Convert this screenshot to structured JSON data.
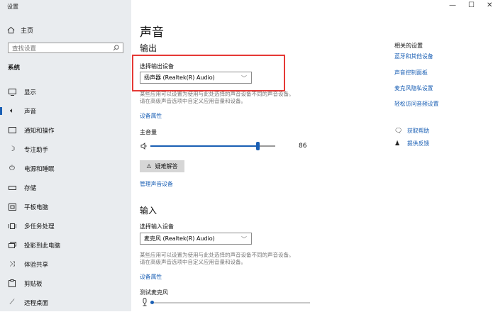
{
  "window": {
    "title": "设置",
    "controls": {
      "minimize": "—",
      "maximize": "☐",
      "close": "✕"
    }
  },
  "sidebar": {
    "home_label": "主页",
    "search_placeholder": "查找设置",
    "section": "系统",
    "items": [
      {
        "label": "显示",
        "icon": "monitor-icon"
      },
      {
        "label": "声音",
        "icon": "speaker-icon",
        "active": true
      },
      {
        "label": "通知和操作",
        "icon": "notification-icon"
      },
      {
        "label": "专注助手",
        "icon": "moon-icon"
      },
      {
        "label": "电源和睡眠",
        "icon": "power-icon"
      },
      {
        "label": "存储",
        "icon": "storage-icon"
      },
      {
        "label": "平板电脑",
        "icon": "tablet-icon"
      },
      {
        "label": "多任务处理",
        "icon": "multitask-icon"
      },
      {
        "label": "投影到此电脑",
        "icon": "projector-icon"
      },
      {
        "label": "体验共享",
        "icon": "share-icon"
      },
      {
        "label": "剪贴板",
        "icon": "clipboard-icon"
      },
      {
        "label": "远程桌面",
        "icon": "remote-icon"
      }
    ]
  },
  "main": {
    "title": "声音",
    "output": {
      "heading": "输出",
      "select_label": "选择输出设备",
      "device": "扬声器 (Realtek(R) Audio)",
      "desc_line1": "某些应用可以设置为使用与此处选择的声音设备不同的声音设备。",
      "desc_line2": "请在高级声音选项中自定义应用音量和设备。",
      "properties_link": "设备属性",
      "volume_label": "主音量",
      "volume_value": "86",
      "volume_fraction": 0.86,
      "troubleshoot": "疑难解答",
      "manage_link": "管理声音设备"
    },
    "input": {
      "heading": "输入",
      "select_label": "选择输入设备",
      "device": "麦克风 (Realtek(R) Audio)",
      "desc_line1": "某些应用可以设置为使用与此处选择的声音设备不同的声音设备。",
      "desc_line2": "请在高级声音选项中自定义应用音量和设备。",
      "properties_link": "设备属性",
      "test_label": "测试麦克风"
    }
  },
  "related": {
    "heading": "相关的设置",
    "links": [
      "蓝牙和其他设备",
      "声音控制面板",
      "麦克风隐私设置",
      "轻松访问音频设置"
    ],
    "help": "获取帮助",
    "feedback": "提供反馈"
  },
  "colors": {
    "accent": "#1a5fb4",
    "highlight": "#e53935",
    "sidebar_bg": "#e9ecef"
  }
}
